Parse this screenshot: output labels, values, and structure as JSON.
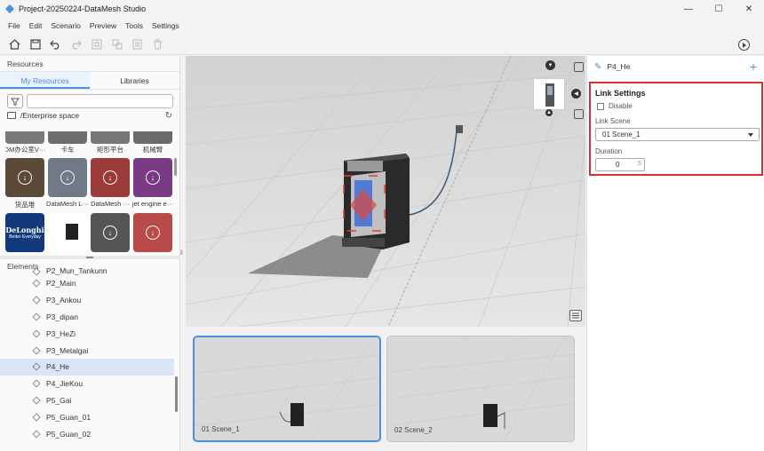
{
  "window": {
    "title": "Project-20250224-DataMesh Studio",
    "controls": [
      "—",
      "☐",
      "✕"
    ]
  },
  "menu": [
    "File",
    "Edit",
    "Scenario",
    "Preview",
    "Tools",
    "Settings"
  ],
  "toolbar": {
    "buttons": [
      {
        "icon": "home-icon",
        "enabled": true
      },
      {
        "icon": "save-icon",
        "enabled": true
      },
      {
        "icon": "undo-icon",
        "enabled": true
      },
      {
        "icon": "redo-icon",
        "enabled": false
      },
      {
        "icon": "frame-icon",
        "enabled": false
      },
      {
        "icon": "transform-icon",
        "enabled": false
      },
      {
        "icon": "document-icon",
        "enabled": false
      },
      {
        "icon": "trash-icon",
        "enabled": false
      }
    ],
    "play_icon": "play-icon"
  },
  "resources": {
    "header": "Resources",
    "tabs": [
      {
        "label": "My Resources",
        "active": true
      },
      {
        "label": "Libraries",
        "active": false
      }
    ],
    "path": "/Enterprise space",
    "items": [
      {
        "label": "DM办公室V···",
        "color": "#7a7a7a"
      },
      {
        "label": "卡车",
        "color": "#6e6e6e"
      },
      {
        "label": "矩形平台",
        "color": "#767676"
      },
      {
        "label": "机械臂",
        "color": "#6a6a6a"
      },
      {
        "label": "货品堆",
        "color": "#5b4a3a"
      },
      {
        "label": "DataMesh L···",
        "color": "#6f7a86"
      },
      {
        "label": "DataMesh ···",
        "color": "#9c3b3b"
      },
      {
        "label": "jet engine e···",
        "color": "#7a3b86"
      },
      {
        "label": "",
        "brand_text": "DeLonghi",
        "brand_sub": "Better Everyday",
        "color": "#123a7a"
      },
      {
        "label": "",
        "color": "#ffffff"
      },
      {
        "label": "",
        "color": "#555555"
      },
      {
        "label": "",
        "color": "#b84a4a"
      }
    ]
  },
  "elements": {
    "header": "Elements",
    "items": [
      {
        "label": "P2_Mun_Tankunn",
        "active": false
      },
      {
        "label": "P2_Main",
        "active": false
      },
      {
        "label": "P3_Ankou",
        "active": false
      },
      {
        "label": "P3_dipan",
        "active": false
      },
      {
        "label": "P3_HeZi",
        "active": false
      },
      {
        "label": "P3_Metalgai",
        "active": false
      },
      {
        "label": "P4_He",
        "active": true
      },
      {
        "label": "P4_JieKou",
        "active": false
      },
      {
        "label": "P5_Gai",
        "active": false
      },
      {
        "label": "P5_Guan_01",
        "active": false
      },
      {
        "label": "P5_Guan_02",
        "active": false
      }
    ]
  },
  "scenes": [
    {
      "label": "01  Scene_1",
      "active": true
    },
    {
      "label": "02  Scene_2",
      "active": false
    }
  ],
  "properties": {
    "element_name": "P4_He",
    "link_settings": {
      "title": "Link Settings",
      "disable_label": "Disable",
      "disable_checked": false,
      "link_scene_label": "Link Scene",
      "link_scene_value": "01  Scene_1",
      "duration_label": "Duration",
      "duration_value": "0",
      "duration_unit": "S"
    }
  },
  "colors": {
    "accent": "#4a90e2",
    "highlight_box": "#d93030",
    "selection": "#d8e6f7"
  }
}
